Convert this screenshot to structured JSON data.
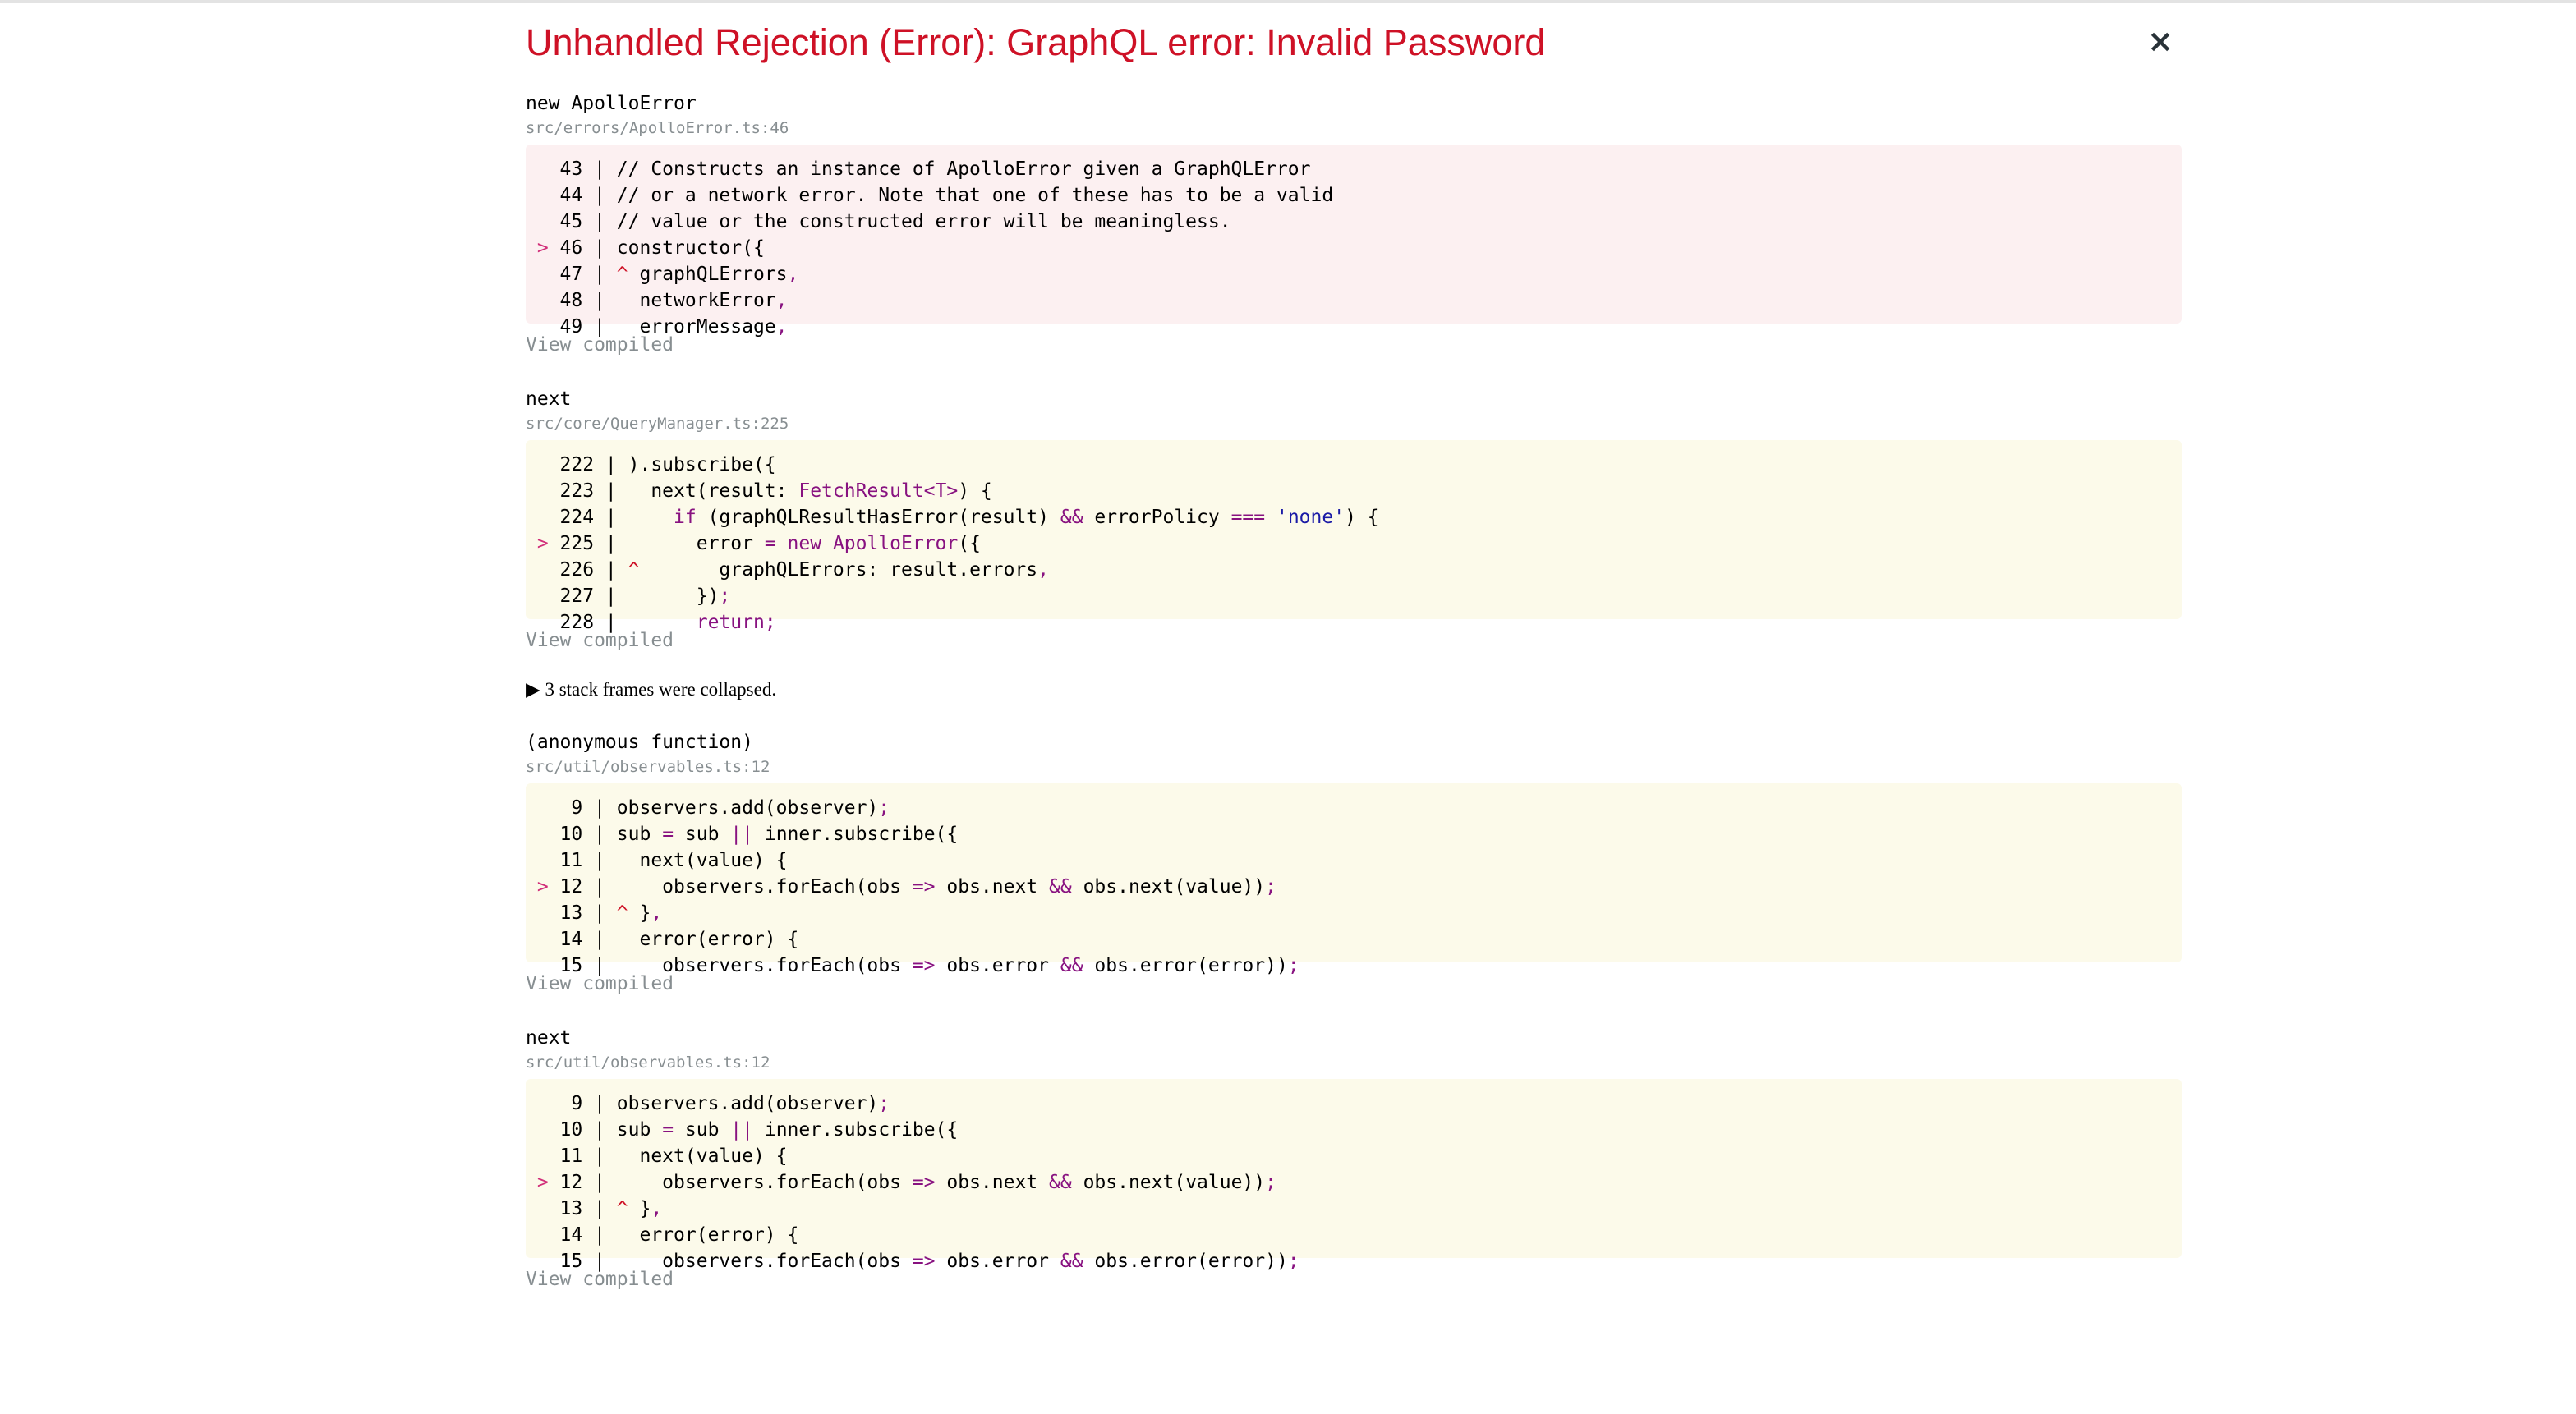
{
  "header": {
    "title": "Unhandled Rejection (Error): GraphQL error: Invalid Password",
    "close_icon": "×"
  },
  "frames": [
    {
      "function": "new ApolloError",
      "file": "src/errors/ApolloError.ts:46",
      "style": "error",
      "lines": [
        {
          "num": "43",
          "marker": " ",
          "code": "// Constructs an instance of ApolloError given a GraphQLError"
        },
        {
          "num": "44",
          "marker": " ",
          "code": "// or a network error. Note that one of these has to be a valid"
        },
        {
          "num": "45",
          "marker": " ",
          "code": "// value or the constructed error will be meaningless."
        },
        {
          "num": "46",
          "marker": ">",
          "code": "constructor({"
        },
        {
          "num": "47",
          "marker": " ",
          "code": "^ graphQLErrors,"
        },
        {
          "num": "48",
          "marker": " ",
          "code": "  networkError,"
        },
        {
          "num": "49",
          "marker": " ",
          "code": "  errorMessage,"
        }
      ],
      "view_compiled": "View compiled"
    },
    {
      "function": "next",
      "file": "src/core/QueryManager.ts:225",
      "style": "warn",
      "lines": [
        {
          "num": "222",
          "marker": " ",
          "code": ").subscribe({"
        },
        {
          "num": "223",
          "marker": " ",
          "code": "  next(result: FetchResult<T>) {"
        },
        {
          "num": "224",
          "marker": " ",
          "code": "    if (graphQLResultHasError(result) && errorPolicy === 'none') {"
        },
        {
          "num": "225",
          "marker": ">",
          "code": "      error = new ApolloError({"
        },
        {
          "num": "226",
          "marker": " ",
          "code": "^       graphQLErrors: result.errors,"
        },
        {
          "num": "227",
          "marker": " ",
          "code": "      });"
        },
        {
          "num": "228",
          "marker": " ",
          "code": "      return;"
        }
      ],
      "view_compiled": "View compiled"
    },
    {
      "function": "(anonymous function)",
      "file": "src/util/observables.ts:12",
      "style": "warn",
      "lines": [
        {
          "num": "9",
          "marker": " ",
          "code": "observers.add(observer);"
        },
        {
          "num": "10",
          "marker": " ",
          "code": "sub = sub || inner.subscribe({"
        },
        {
          "num": "11",
          "marker": " ",
          "code": "  next(value) {"
        },
        {
          "num": "12",
          "marker": ">",
          "code": "    observers.forEach(obs => obs.next && obs.next(value));"
        },
        {
          "num": "13",
          "marker": " ",
          "code": "^ },"
        },
        {
          "num": "14",
          "marker": " ",
          "code": "  error(error) {"
        },
        {
          "num": "15",
          "marker": " ",
          "code": "    observers.forEach(obs => obs.error && obs.error(error));"
        }
      ],
      "view_compiled": "View compiled"
    },
    {
      "function": "next",
      "file": "src/util/observables.ts:12",
      "style": "warn",
      "lines": [
        {
          "num": "9",
          "marker": " ",
          "code": "observers.add(observer);"
        },
        {
          "num": "10",
          "marker": " ",
          "code": "sub = sub || inner.subscribe({"
        },
        {
          "num": "11",
          "marker": " ",
          "code": "  next(value) {"
        },
        {
          "num": "12",
          "marker": ">",
          "code": "    observers.forEach(obs => obs.next && obs.next(value));"
        },
        {
          "num": "13",
          "marker": " ",
          "code": "^ },"
        },
        {
          "num": "14",
          "marker": " ",
          "code": "  error(error) {"
        },
        {
          "num": "15",
          "marker": " ",
          "code": "    observers.forEach(obs => obs.error && obs.error(error));"
        }
      ],
      "view_compiled": "View compiled"
    }
  ],
  "collapsed_label": "▶ 3 stack frames were collapsed.",
  "colors": {
    "title": "#ce1126",
    "error_bg": "#fcf0f1",
    "warn_bg": "#fcfaea",
    "muted": "#878e91"
  }
}
